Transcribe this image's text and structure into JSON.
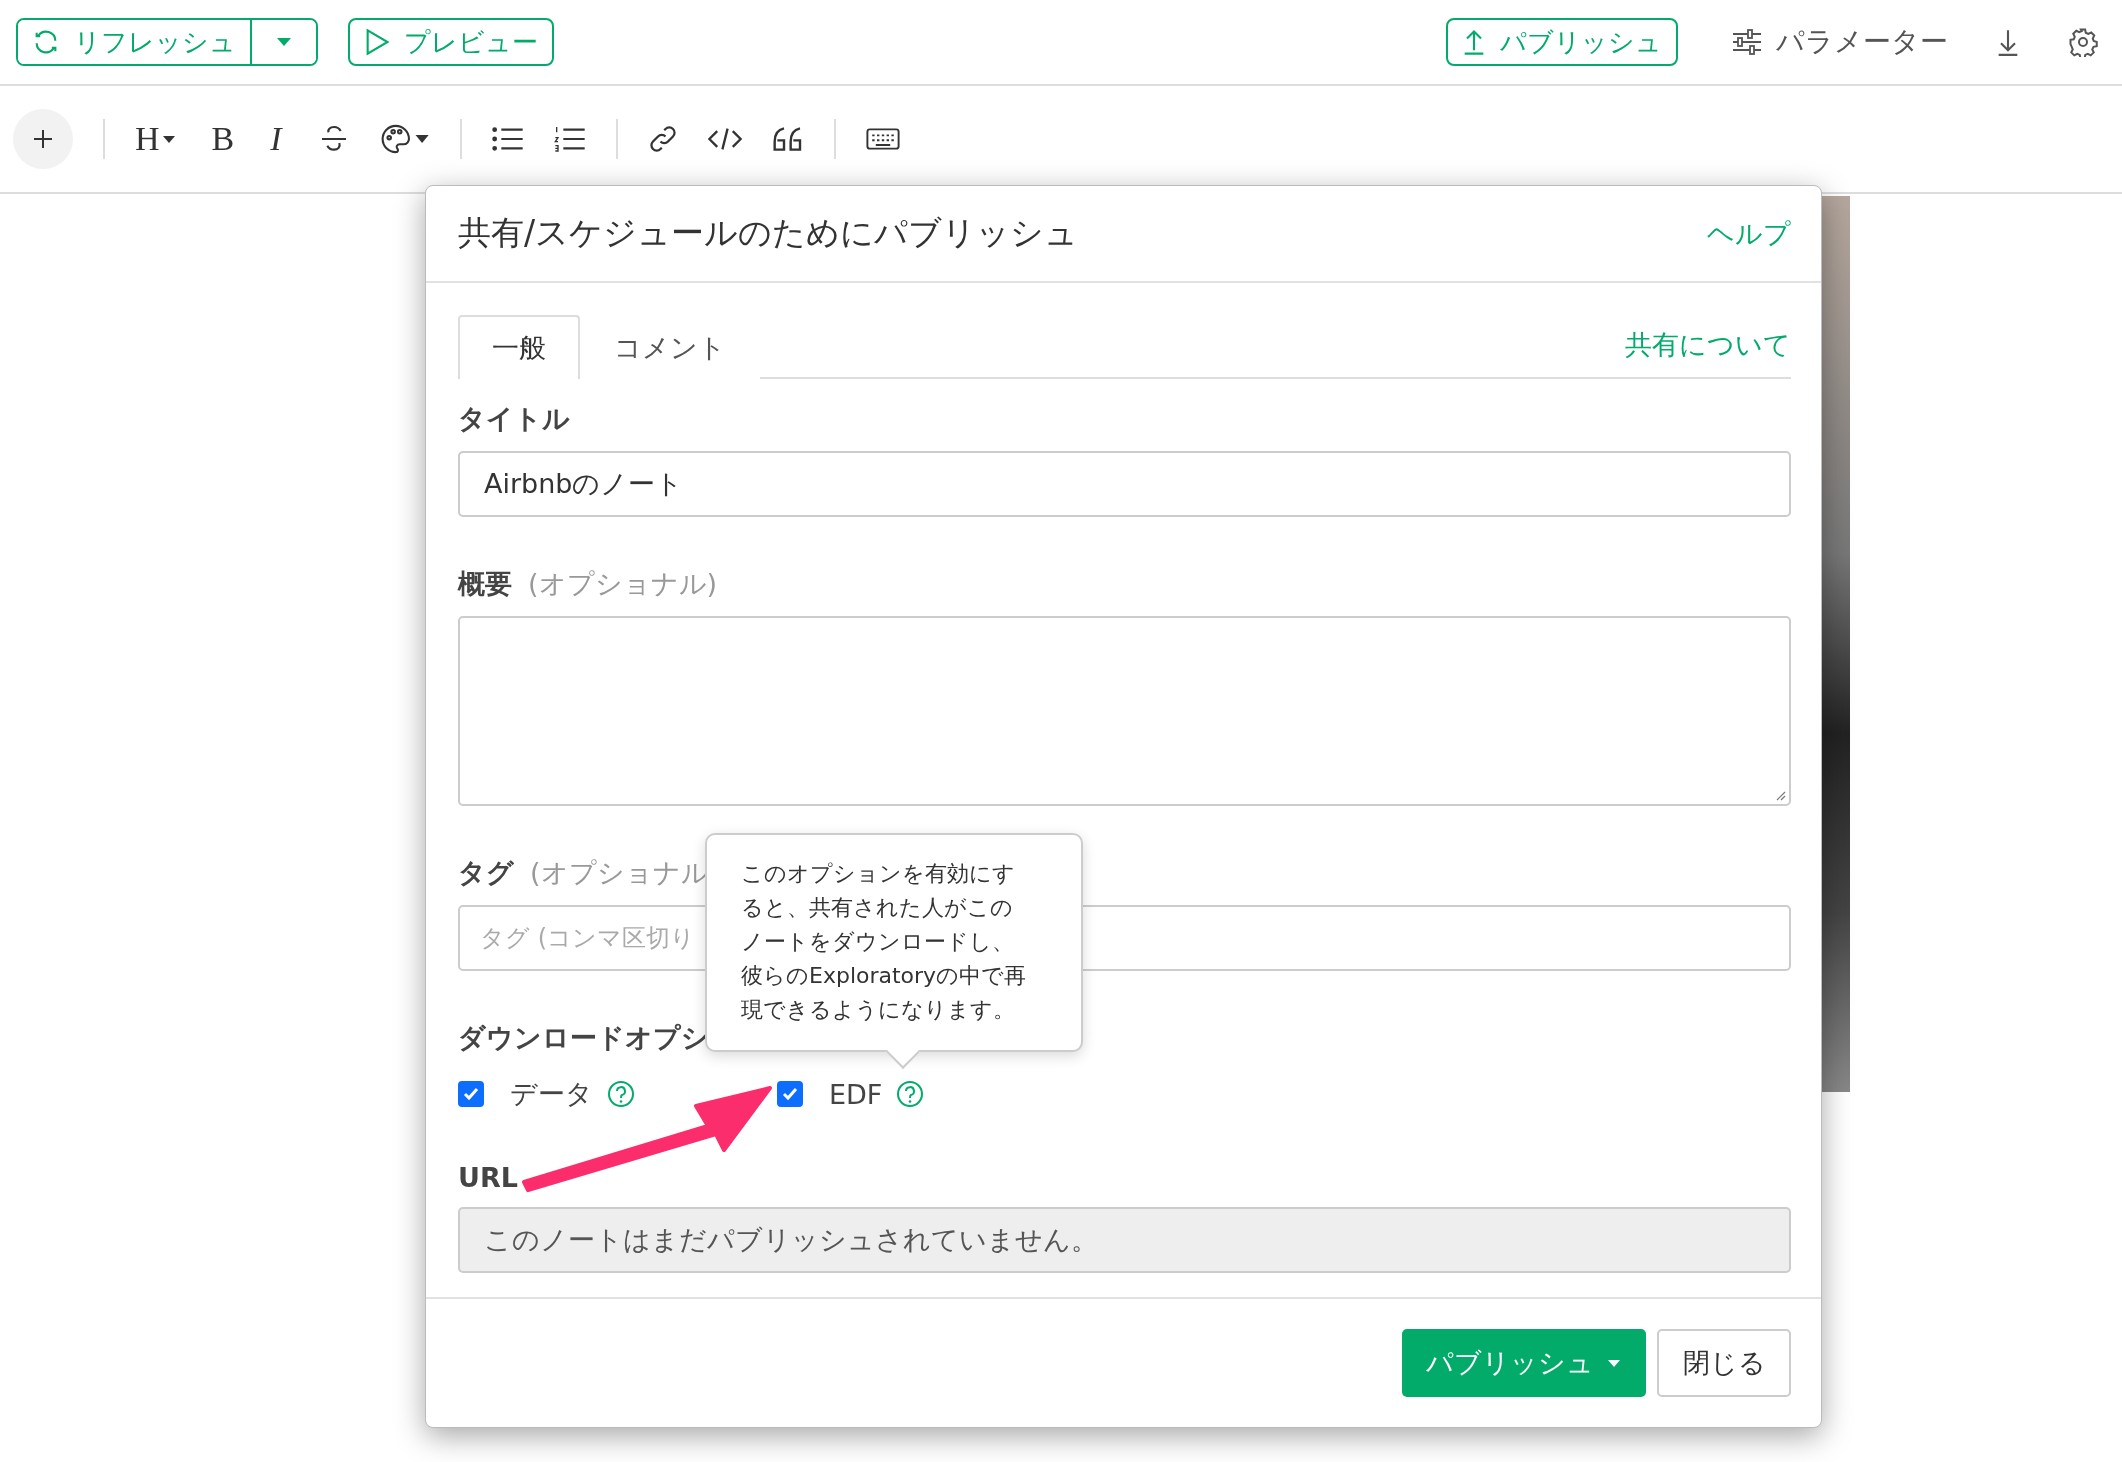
{
  "top_bar": {
    "refresh": "リフレッシュ",
    "preview": "プレビュー",
    "publish": "パブリッシュ",
    "parameters": "パラメーター"
  },
  "editor_toolbar": {
    "heading": "H",
    "bold": "B",
    "italic": "I"
  },
  "dialog": {
    "title": "共有/スケジュールのためにパブリッシュ",
    "help": "ヘルプ",
    "tabs": [
      {
        "label": "一般",
        "selected": true
      },
      {
        "label": "コメント",
        "selected": false
      }
    ],
    "about_link": "共有について",
    "title_label": "タイトル",
    "title_value": "Airbnbのノート",
    "summary_label": "概要",
    "summary_optional": "(オプショナル)",
    "tags_label": "タグ",
    "tags_optional": "(オプショナル",
    "tags_placeholder": "タグ (コンマ区切り",
    "download_label": "ダウンロードオプシ",
    "download_options": [
      {
        "label": "データ",
        "checked": true
      },
      {
        "label": "EDF",
        "checked": true
      }
    ],
    "url_label": "URL",
    "url_value": "このノートはまだパブリッシュされていません。",
    "publish_button": "パブリッシュ",
    "close_button": "閉じる"
  },
  "tooltip": "このオプションを有効にすると、共有された人がこのノートをダウンロードし、彼らのExploratoryの中で再現できるようになります。"
}
